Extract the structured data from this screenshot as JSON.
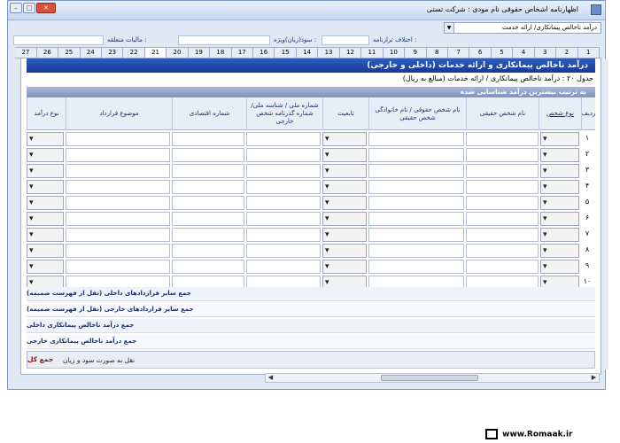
{
  "window": {
    "title": "اظهارنامه اشخاص حقوقی   نام مودی : شرکت تستی",
    "buttons": {
      "minimize": "–",
      "maximize": "□",
      "close": "✕"
    }
  },
  "header": {
    "combo_value": "درآمد ناخالص پیمانکاری/ ارائه خدمت",
    "fields": {
      "tax_due_label": "مالیات متعلقه :",
      "profit_label": "سود(زیان)ویژه :",
      "discrepancy_label": "اختلاف ترازنامه :"
    }
  },
  "tabs": [
    "1",
    "2",
    "3",
    "4",
    "5",
    "6",
    "7",
    "8",
    "9",
    "10",
    "11",
    "12",
    "13",
    "14",
    "15",
    "16",
    "17",
    "18",
    "19",
    "20",
    "21",
    "22",
    "23",
    "24",
    "25",
    "26",
    "27"
  ],
  "active_tab": "21",
  "form": {
    "title": "درآمد ناخالص پیمانکاری و ارائه خدمات (داخلی و خارجی)",
    "subtitle": "(جدول ۲۰ : درآمد ناخالص پیمانکاری / ارائه خدمات (مبالغ به ریال",
    "sort_note": "به ترتیب بیشترین درآمد شناسایی شده"
  },
  "table": {
    "headers": {
      "row": "ردیف",
      "person_type": "نوع شخص",
      "real_name": "نام شخص حقیقی",
      "legal_name": "نام شخص حقوقی / نام خانوادگی شخص حقیقی",
      "nationality": "تابعیت",
      "national_id": "شماره ملی / شناسه ملی/شماره گذرنامه شخص خارجی",
      "economic_code": "شماره اقتصادی",
      "contract_subject": "موضوع قرارداد",
      "income_type": "نوع درآمد"
    },
    "rows": [
      "۱",
      "۲",
      "۳",
      "۴",
      "۵",
      "۶",
      "۷",
      "۸",
      "۹",
      "۱۰"
    ]
  },
  "summary": {
    "lines": [
      "جمع سایر قراردادهای داخلی (نقل از فهرست ضمیمه)",
      "جمع سایر قراردادهای خارجی (نقل از فهرست ضمیمه)",
      "جمع درآمد ناخالص پیمانکاری داخلی",
      "جمع درآمد ناخالص پیمانکاری خارجی"
    ],
    "total_label": "جمع کل",
    "total_note": "نقل به صورت سود و زیان"
  },
  "watermark": "www.Romaak.ir"
}
